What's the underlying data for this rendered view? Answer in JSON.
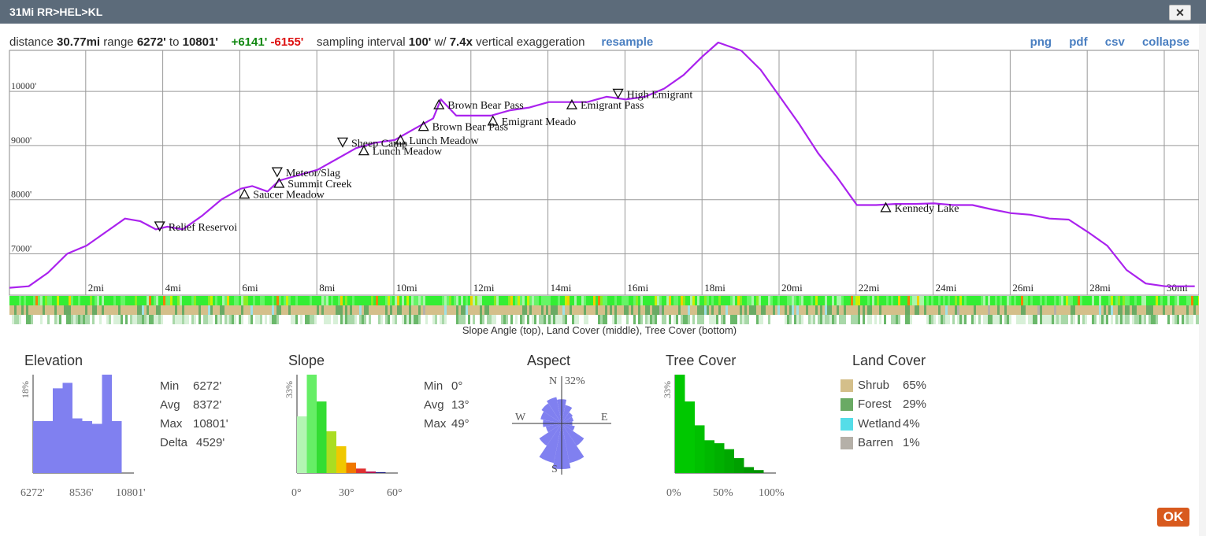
{
  "window": {
    "title": "31Mi RR>HEL>KL",
    "close_label": "✕"
  },
  "summary": {
    "distance_label": "distance",
    "distance": "30.77mi",
    "range_label": "range",
    "range_min": "6272'",
    "range_to": "to",
    "range_max": "10801'",
    "gain": "+6141'",
    "loss": "-6155'",
    "sampling_label": "sampling interval",
    "sampling": "100'",
    "w_label": "w/",
    "exaggeration": "7.4x",
    "exaggeration_label": "vertical exaggeration",
    "resample": "resample"
  },
  "links": {
    "png": "png",
    "pdf": "pdf",
    "csv": "csv",
    "collapse": "collapse"
  },
  "chart_data": {
    "type": "line",
    "xlabel": "",
    "ylabel": "",
    "x_unit": "mi",
    "x_ticks": [
      "2mi",
      "4mi",
      "6mi",
      "8mi",
      "10mi",
      "12mi",
      "14mi",
      "16mi",
      "18mi",
      "20mi",
      "22mi",
      "24mi",
      "26mi",
      "28mi",
      "30mi"
    ],
    "y_ticks": [
      "7000'",
      "8000'",
      "9000'",
      "10000'"
    ],
    "xlim": [
      0,
      30.77
    ],
    "ylim": [
      6200,
      10801
    ],
    "series": [
      {
        "x": [
          0,
          0.5,
          1,
          1.5,
          2,
          2.5,
          3,
          3.4,
          3.8,
          4.1,
          4.5,
          5,
          5.5,
          6,
          6.3,
          6.7,
          7,
          7.5,
          8,
          8.5,
          9,
          9.5,
          10,
          10.5,
          11,
          11.2,
          11.6,
          12,
          12.5,
          13,
          13.5,
          14,
          14.5,
          15,
          15.5,
          16,
          16.5,
          17,
          17.5,
          18,
          18.4,
          19,
          19.5,
          20,
          20.5,
          21,
          21.5,
          22,
          22.5,
          23,
          23.5,
          24,
          24.5,
          25,
          25.5,
          26,
          26.5,
          27,
          27.5,
          28,
          28.5,
          29,
          29.5,
          30,
          30.77
        ],
        "y": [
          6272,
          6300,
          6550,
          6900,
          7050,
          7300,
          7550,
          7500,
          7350,
          7400,
          7350,
          7600,
          7900,
          8100,
          8150,
          8050,
          8250,
          8350,
          8450,
          8650,
          8850,
          8950,
          9000,
          9200,
          9400,
          9750,
          9450,
          9450,
          9450,
          9550,
          9600,
          9700,
          9700,
          9700,
          9800,
          9750,
          9800,
          9950,
          10200,
          10550,
          10801,
          10650,
          10300,
          9800,
          9300,
          8750,
          8300,
          7800,
          7800,
          7820,
          7820,
          7830,
          7800,
          7800,
          7720,
          7650,
          7620,
          7550,
          7530,
          7300,
          7050,
          6600,
          6350,
          6300,
          6300
        ]
      }
    ],
    "waypoints": [
      {
        "name": "Relief Reservoi",
        "x": 3.9,
        "y": 7400,
        "sym": "down"
      },
      {
        "name": "Saucer Meadow",
        "x": 6.1,
        "y": 8000,
        "sym": "up"
      },
      {
        "name": "Summit Creek",
        "x": 7.0,
        "y": 8200,
        "sym": "up"
      },
      {
        "name": "Meteor/Slag",
        "x": 6.95,
        "y": 8400,
        "sym": "down"
      },
      {
        "name": "Lunch Meadow",
        "x": 9.2,
        "y": 8800,
        "sym": "up"
      },
      {
        "name": "Sheep Camp",
        "x": 8.65,
        "y": 8950,
        "sym": "down"
      },
      {
        "name": "Lunch Meadow",
        "x": 10.15,
        "y": 9000,
        "sym": "up"
      },
      {
        "name": "Brown Bear Pass",
        "x": 10.75,
        "y": 9250,
        "sym": "up"
      },
      {
        "name": "Brown Bear Pass",
        "x": 11.15,
        "y": 9650,
        "sym": "up"
      },
      {
        "name": "Emigrant Meado",
        "x": 12.55,
        "y": 9350,
        "sym": "up"
      },
      {
        "name": "Emigrant Pass",
        "x": 14.6,
        "y": 9650,
        "sym": "up"
      },
      {
        "name": "High Emigrant",
        "x": 15.8,
        "y": 9850,
        "sym": "down"
      },
      {
        "name": "Kennedy Lake",
        "x": 22.75,
        "y": 7750,
        "sym": "up"
      }
    ],
    "strips_caption": "Slope Angle (top), Land Cover (middle), Tree Cover (bottom)"
  },
  "elevation": {
    "title": "Elevation",
    "ytick": "18%",
    "x_labels": [
      "6272'",
      "8536'",
      "10801'"
    ],
    "bars_pct": [
      9.5,
      9.5,
      15.5,
      16.5,
      10,
      9.5,
      9,
      18,
      9.5
    ],
    "stats": [
      {
        "label": "Min",
        "value": "6272'"
      },
      {
        "label": "Avg",
        "value": "8372'"
      },
      {
        "label": "Max",
        "value": "10801'"
      },
      {
        "label": "Delta",
        "value": "4529'"
      }
    ],
    "color": "#8080f0"
  },
  "slope": {
    "title": "Slope",
    "ytick": "33%",
    "x_labels": [
      "0°",
      "30°",
      "60°"
    ],
    "bars_pct": [
      19,
      33,
      24,
      14,
      9,
      3.5,
      1.5,
      0.5,
      0.3
    ],
    "bar_colors": [
      "#b3f5b3",
      "#66ee66",
      "#33dd33",
      "#aadd22",
      "#f0c800",
      "#f07800",
      "#e03030",
      "#b01050",
      "#202080"
    ],
    "stats": [
      {
        "label": "Min",
        "value": "0°"
      },
      {
        "label": "Avg",
        "value": "13°"
      },
      {
        "label": "Max",
        "value": "49°"
      }
    ]
  },
  "aspect": {
    "title": "Aspect",
    "labels": {
      "n": "N",
      "e": "E",
      "s": "S",
      "w": "W"
    },
    "max_label": "32%",
    "sectors_pct": [
      18,
      14,
      10,
      9,
      8,
      10,
      20,
      30,
      34,
      30,
      20,
      12,
      14,
      16,
      18,
      20
    ],
    "color": "#8080f0"
  },
  "tree_cover": {
    "title": "Tree Cover",
    "ytick": "33%",
    "x_labels": [
      "0%",
      "50%",
      "100%"
    ],
    "bars_pct": [
      33,
      24,
      16,
      11,
      10,
      8,
      5,
      2,
      1
    ],
    "bar_colors": [
      "#00c800",
      "#00c800",
      "#00c000",
      "#00b800",
      "#00b000",
      "#00a800",
      "#00a000",
      "#009800",
      "#009000"
    ]
  },
  "land_cover": {
    "title": "Land Cover",
    "items": [
      {
        "name": "Shrub",
        "value": "65%",
        "color": "#d4bf8a"
      },
      {
        "name": "Forest",
        "value": "29%",
        "color": "#6aaa64"
      },
      {
        "name": "Wetland",
        "value": "4%",
        "color": "#55dde8"
      },
      {
        "name": "Barren",
        "value": "1%",
        "color": "#b5b0a8"
      }
    ]
  },
  "ok_label": "OK",
  "colors": {
    "title_bar": "#5c6b7a",
    "profile_line": "#aa22ee",
    "accent_link": "#4a7fc1",
    "ok_button": "#d85a1e"
  }
}
